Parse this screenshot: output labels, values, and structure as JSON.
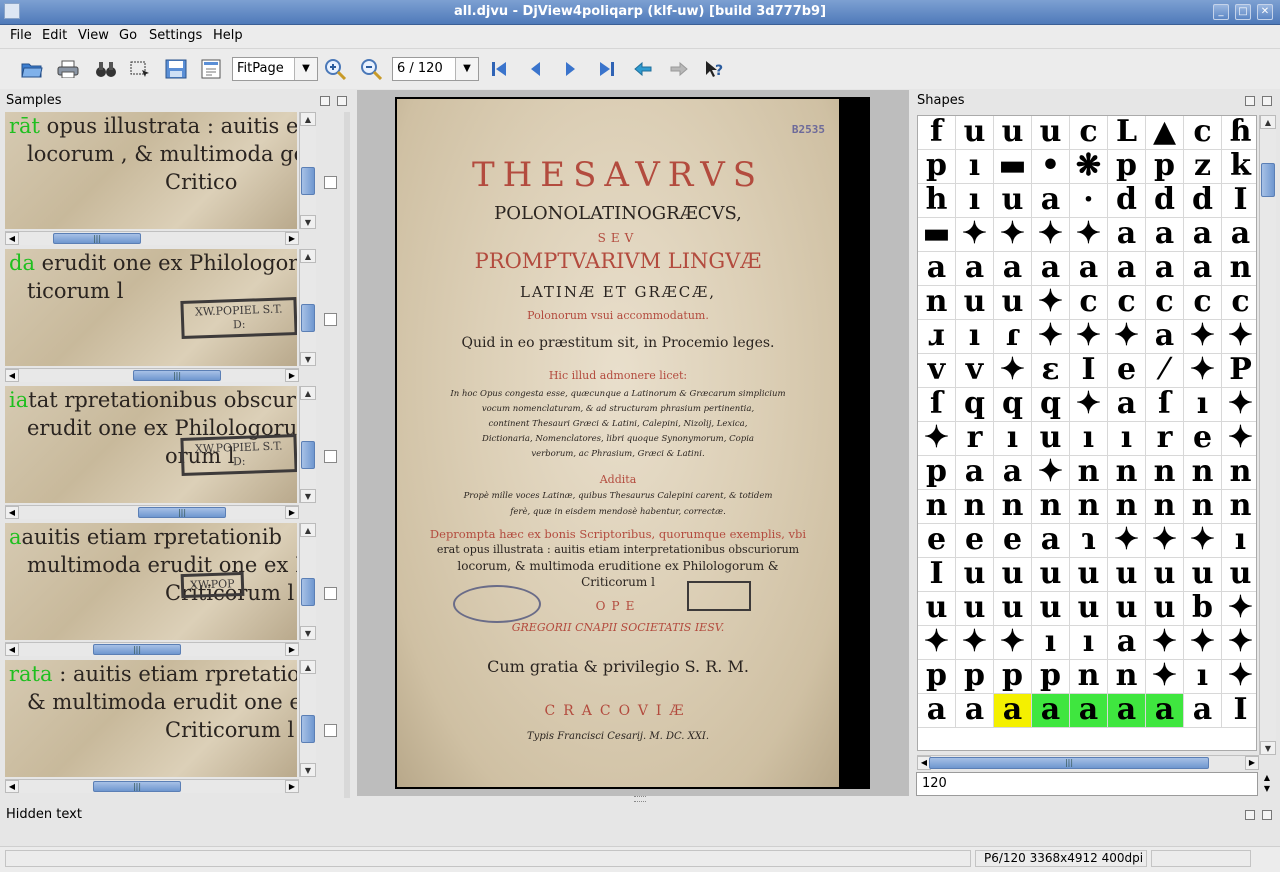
{
  "window": {
    "title": "all.djvu - DjView4poliqarp (klf-uw) [build 3d777b9]"
  },
  "menu": {
    "items": [
      "File",
      "Edit",
      "View",
      "Go",
      "Settings",
      "Help"
    ]
  },
  "toolbar": {
    "zoom_mode": "FitPage",
    "page_indicator": "6 / 120",
    "icons": [
      "open-folder-icon",
      "print-icon",
      "find-binoculars-icon",
      "select-region-icon",
      "save-icon",
      "export-icon",
      "zoom-in-icon",
      "zoom-out-icon",
      "first-page-icon",
      "previous-page-icon",
      "next-page-icon",
      "last-page-icon",
      "back-icon",
      "forward-icon",
      "whats-this-help-icon"
    ]
  },
  "samples_panel": {
    "title": "Samples",
    "samples": [
      {
        "line1_pre": "",
        "line1_hl": "rāt",
        "line1_post": " opus illustrata : auitis etia",
        "line2": "locorum , & multimoda ge",
        "line3": "Critico",
        "stamp": ""
      },
      {
        "line1_pre": "",
        "line1_hl": "da",
        "line1_post": " erudit one ex Philologorum",
        "line2": "ticorum l",
        "line3": "",
        "stamp": "XW.POPIEL S.T. D:"
      },
      {
        "line1_pre": "",
        "line1_hl": "ia",
        "line1_post": "tat rpretationibus obscur",
        "line2": "erudit one ex Philologorum",
        "line3": "orum l",
        "stamp": "XW.POPIEL S.T. D:"
      },
      {
        "line1_pre": " ",
        "line1_hl": "a",
        "line1_post": "auitis etiam rpretationib",
        "line2": "multimoda erudit one ex Philo",
        "line3": "Criticorum l",
        "stamp": "XW.POP"
      },
      {
        "line1_pre": "",
        "line1_hl": "rata",
        "line1_post": " : auitis etiam rpretatio",
        "line2": "& multimoda erudit one ex",
        "line3": "Criticorum l",
        "stamp": ""
      }
    ]
  },
  "page": {
    "stamp": "B2535",
    "lines": [
      "THESAVRVS",
      "POLONOLATINOGRÆCVS,",
      "SEV",
      "PROMPTVARIVM LINGVÆ",
      "LATINÆ ET GRÆCÆ,",
      "Polonorum vsui accommodatum.",
      "Quid in eo præstitum sit, in Procemio leges.",
      "Hic illud admonere licet:",
      "In hoc Opus congesta esse, quæcunque a Latinorum & Græcarum simplicium",
      "vocum nomenclaturam, & ad structuram phrasium pertinentia,",
      "continent Thesauri Græci & Latini, Calepini, Nizolij, Lexica,",
      "Dictionaria, Nomenclatores, libri quoque Synonymorum, Copia",
      "verborum, ac Phrasium, Græci & Latini.",
      "Addita",
      "Propè mille voces Latinæ, quibus Thesaurus Calepini carent, & totidem",
      "ferè, quæ in eisdem mendosè habentur, correctæ.",
      "Deprompta hæc ex bonis Scriptoribus, quorumque exemplis, vbi",
      "erat opus illustrata : auitis etiam interpretationibus obscuriorum",
      "locorum, & multimoda eruditione ex Philologorum &",
      "Criticorum l",
      "OPE",
      "GREGORII CNAPII   SOCIETATIS IESV.",
      "Cum gratia & privilegio S. R. M.",
      "CRACOVIÆ",
      "Typis Francisci Cesarij.   M. DC. XXI."
    ]
  },
  "shapes_panel": {
    "title": "Shapes",
    "input_value": "120",
    "rows": [
      [
        "f",
        "u",
        "u",
        "u",
        "c",
        "L",
        "▲",
        "c",
        "ɦ"
      ],
      [
        "p",
        "ı",
        "▬",
        "•",
        "❋",
        "p",
        "p",
        "z",
        "k"
      ],
      [
        "h",
        "ı",
        "u",
        "a",
        "·",
        "d",
        "d",
        "d",
        "I"
      ],
      [
        "▬",
        "✦",
        "✦",
        "✦",
        "✦",
        "a",
        "a",
        "a",
        "a"
      ],
      [
        "a",
        "a",
        "a",
        "a",
        "a",
        "a",
        "a",
        "a",
        "n"
      ],
      [
        "n",
        "u",
        "u",
        "✦",
        "c",
        "c",
        "c",
        "c",
        "c"
      ],
      [
        "ɹ",
        "ı",
        "ɾ",
        "✦",
        "✦",
        "✦",
        "a",
        "✦",
        "✦"
      ],
      [
        "v",
        "v",
        "✦",
        "ε",
        "I",
        "e",
        "⁄",
        "✦",
        "P"
      ],
      [
        "ſ",
        "q",
        "q",
        "q",
        "✦",
        "a",
        "ſ",
        "ı",
        "✦"
      ],
      [
        "✦",
        "r",
        "ı",
        "u",
        "ı",
        "ı",
        "r",
        "e",
        "✦"
      ],
      [
        "p",
        "a",
        "a",
        "✦",
        "n",
        "n",
        "n",
        "n",
        "n"
      ],
      [
        "n",
        "n",
        "n",
        "n",
        "n",
        "n",
        "n",
        "n",
        "n"
      ],
      [
        "e",
        "e",
        "e",
        "a",
        "ɿ",
        "✦",
        "✦",
        "✦",
        "ı"
      ],
      [
        "I",
        "u",
        "u",
        "u",
        "u",
        "u",
        "u",
        "u",
        "u"
      ],
      [
        "u",
        "u",
        "u",
        "u",
        "u",
        "u",
        "u",
        "b",
        "✦"
      ],
      [
        "✦",
        "✦",
        "✦",
        "ı",
        "ı",
        "a",
        "✦",
        "✦",
        "✦"
      ],
      [
        "p",
        "p",
        "p",
        "p",
        "n",
        "n",
        "✦",
        "ı",
        "✦"
      ],
      [
        "a",
        "a",
        "a",
        "a",
        "a",
        "a",
        "a",
        "a",
        "I"
      ]
    ],
    "highlight_row": 17,
    "yellow_cells": [
      2
    ],
    "green_cells": [
      3,
      4,
      5,
      6
    ]
  },
  "hidden_text_panel": {
    "title": "Hidden text"
  },
  "statusbar": {
    "page_info": "P6/120 3368x4912 400dpi"
  },
  "colors": {
    "titlebar": "#4f7ab9",
    "highlight_green": "#3fe63f",
    "highlight_yellow": "#f4f000",
    "rubric_red": "#b34b3e"
  }
}
